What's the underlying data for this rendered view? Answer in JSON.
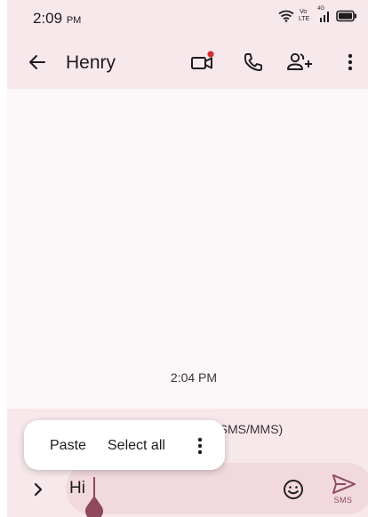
{
  "status_bar": {
    "time": "2:09",
    "ampm": "PM",
    "icons": [
      "wifi-icon",
      "volte-lte-icon",
      "signal-icon",
      "battery-icon"
    ],
    "network_top": "Vo",
    "network_bottom": "LTE",
    "network_gen": "4G"
  },
  "app_bar": {
    "contact_name": "Henry",
    "icons": [
      "back-arrow-icon",
      "video-call-icon",
      "phone-icon",
      "add-person-icon",
      "more-vert-icon"
    ],
    "video_badge_color": "#d32f2f"
  },
  "conversation": {
    "timestamp": "2:04 PM"
  },
  "context_menu": {
    "paste_label": "Paste",
    "select_all_label": "Select all"
  },
  "compose": {
    "sms_hint_suffix": "(SMS/MMS)",
    "input_value": "Hi",
    "send_label": "SMS",
    "accent_color": "#8e4a5a"
  }
}
